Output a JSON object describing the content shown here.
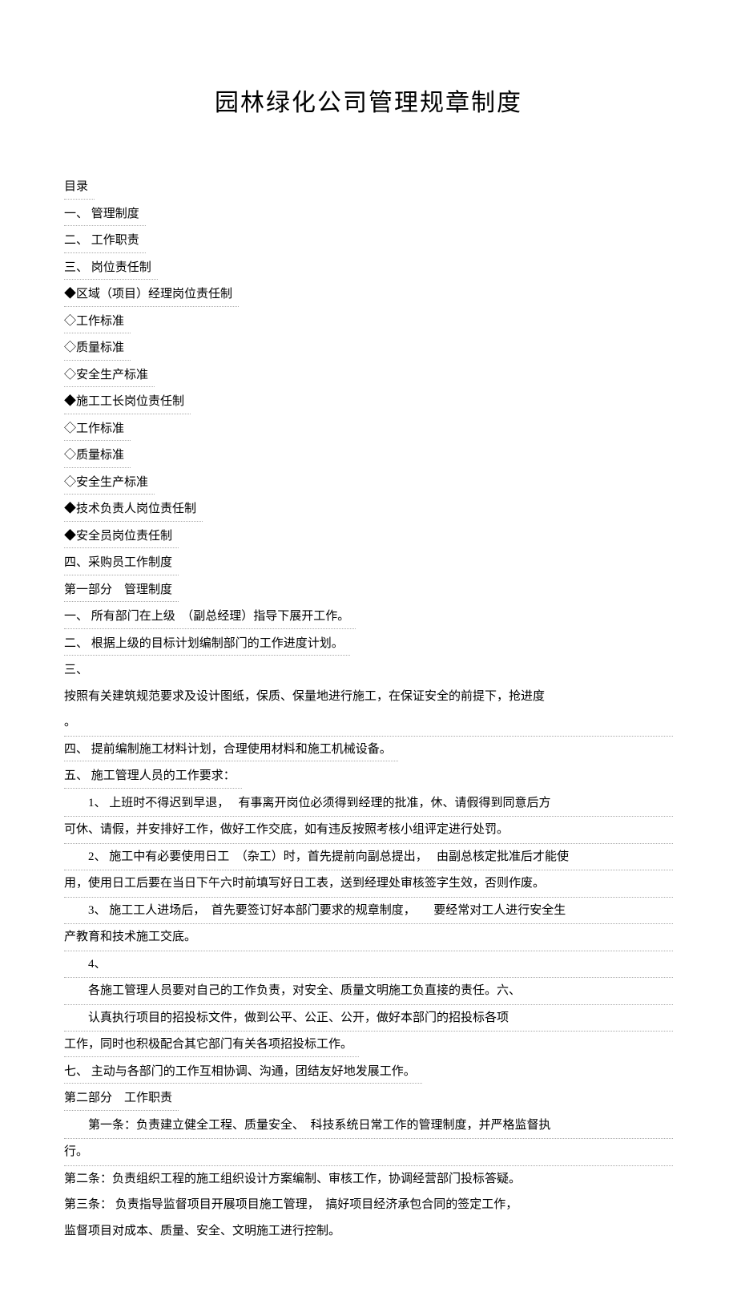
{
  "title": "园林绿化公司管理规章制度",
  "toc": {
    "heading": "目录",
    "items": [
      "一、 管理制度",
      "二、 工作职责",
      "三、 岗位责任制",
      "◆区域（项目）经理岗位责任制",
      "◇工作标准",
      "◇质量标准",
      "◇安全生产标准",
      "◆施工工长岗位责任制",
      "◇工作标准",
      "◇质量标准",
      "◇安全生产标准",
      "◆技术负责人岗位责任制",
      "◆安全员岗位责任制",
      "四、采购员工作制度"
    ]
  },
  "part1": {
    "heading": "第一部分　管理制度",
    "l1": "一、 所有部门在上级　（副总经理）指导下展开工作。",
    "l2": "二、 根据上级的目标计划编制部门的工作进度计划。",
    "l3a": "三、",
    "l3b": "按照有关建筑规范要求及设计图纸，保质、保量地进行施工，在保证安全的前提下，抢进度",
    "l3c": "。",
    "l4": "四、 提前编制施工材料计划，合理使用材料和施工机械设备。",
    "l5": "五、 施工管理人员的工作要求：",
    "l5_1a": "1、 上班时不得迟到早退，　 有事离开岗位必须得到经理的批准，休、请假得到同意后方",
    "l5_1b": "可休、请假，并安排好工作，做好工作交底，如有违反按照考核小组评定进行处罚。",
    "l5_2a": "2、 施工中有必要使用日工　（杂工）时，首先提前向副总提出，　 由副总核定批准后才能使",
    "l5_2b": "用，使用日工后要在当日下午六时前填写好日工表，送到经理处审核签字生效，否则作废。",
    "l5_3a": "3、 施工工人进场后，　首先要签订好本部门要求的规章制度，　　要经常对工人进行安全生",
    "l5_3b": "产教育和技术施工交底。",
    "l5_4": "4、",
    "l5_4b": "各施工管理人员要对自己的工作负责，对安全、质量文明施工负直接的责任。六、",
    "l6a": "认真执行项目的招投标文件，做到公平、公正、公开，做好本部门的招投标各项",
    "l6b": "工作，同时也积极配合其它部门有关各项招投标工作。",
    "l7": "七、 主动与各部门的工作互相协调、沟通，团结友好地发展工作。"
  },
  "part2": {
    "heading": "第二部分　工作职责",
    "a1a": "第一条：负责建立健全工程、质量安全、　科技系统日常工作的管理制度，并严格监督执",
    "a1b": "行。",
    "a2": "第二条：负责组织工程的施工组织设计方案编制、审核工作，协调经营部门投标答疑。",
    "a3a": "第三条： 负责指导监督项目开展项目施工管理，　搞好项目经济承包合同的签定工作，",
    "a3b": "监督项目对成本、质量、安全、文明施工进行控制。"
  }
}
